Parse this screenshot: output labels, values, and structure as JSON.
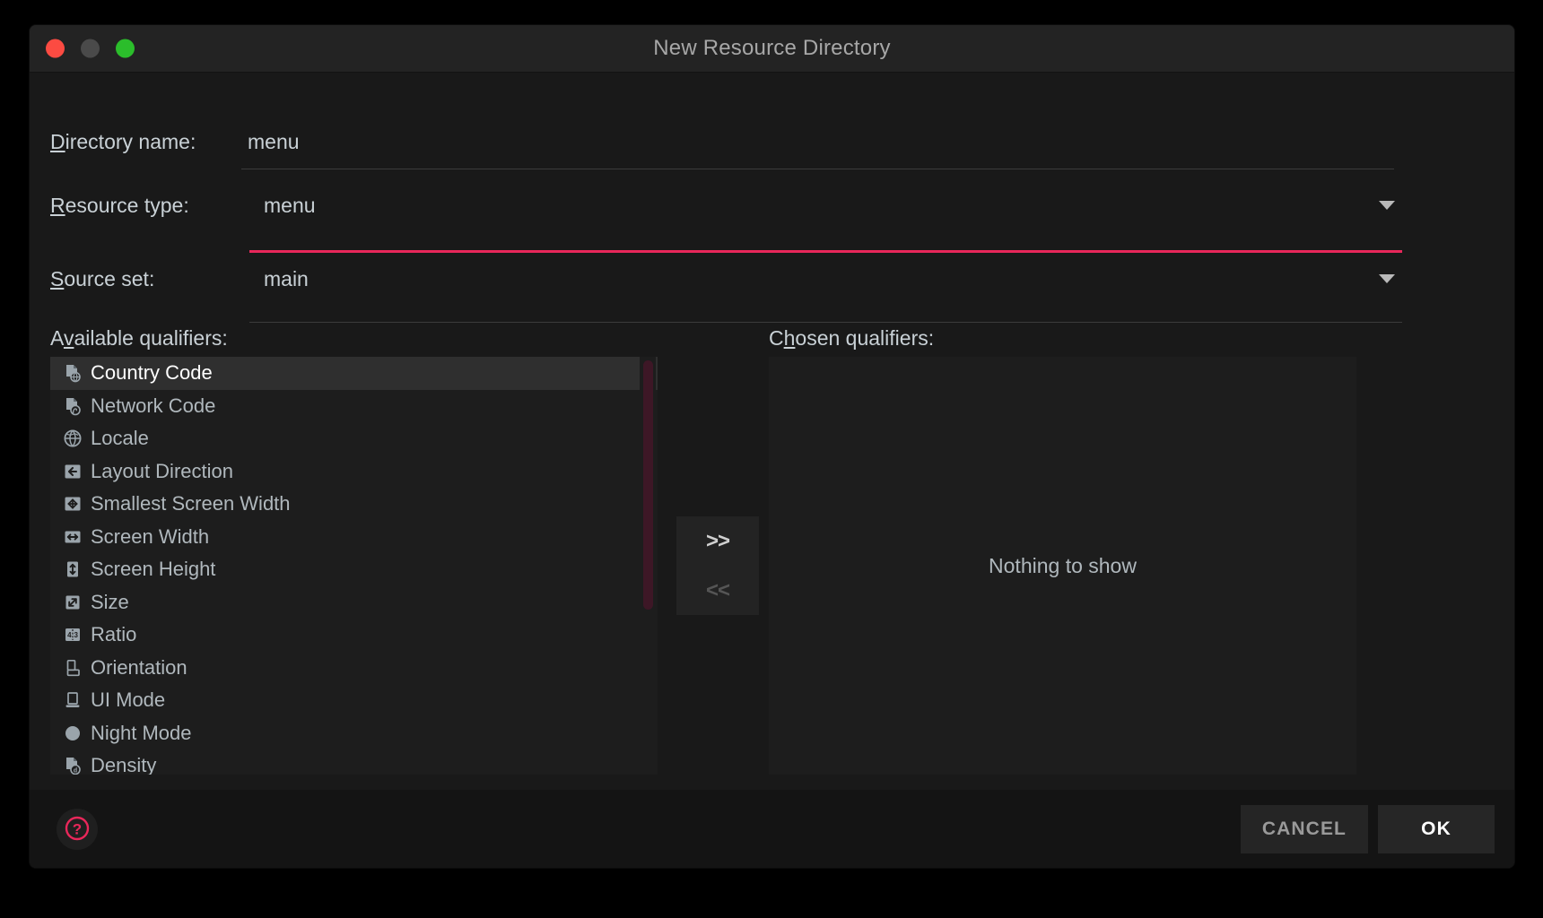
{
  "window": {
    "title": "New Resource Directory",
    "controls": {
      "close": "close",
      "minimize": "minimize",
      "maximize": "maximize"
    }
  },
  "form": {
    "directory_name": {
      "label": "Directory name:",
      "mnemonic": "D",
      "value": "menu"
    },
    "resource_type": {
      "label": "Resource type:",
      "mnemonic": "R",
      "value": "menu",
      "focused": true,
      "focus_color": "#e8275a"
    },
    "source_set": {
      "label": "Source set:",
      "mnemonic": "S",
      "value": "main"
    }
  },
  "qualifiers": {
    "available_label": "Available qualifiers:",
    "available_mnemonic": "v",
    "chosen_label": "Chosen qualifiers:",
    "chosen_mnemonic": "h",
    "chosen_empty_text": "Nothing to show",
    "available_items": [
      {
        "label": "Country Code",
        "icon": "country-code-icon",
        "selected": true
      },
      {
        "label": "Network Code",
        "icon": "network-code-icon",
        "selected": false
      },
      {
        "label": "Locale",
        "icon": "locale-globe-icon",
        "selected": false
      },
      {
        "label": "Layout Direction",
        "icon": "layout-direction-icon",
        "selected": false
      },
      {
        "label": "Smallest Screen Width",
        "icon": "smallest-screen-width-icon",
        "selected": false
      },
      {
        "label": "Screen Width",
        "icon": "screen-width-icon",
        "selected": false
      },
      {
        "label": "Screen Height",
        "icon": "screen-height-icon",
        "selected": false
      },
      {
        "label": "Size",
        "icon": "size-icon",
        "selected": false
      },
      {
        "label": "Ratio",
        "icon": "ratio-icon",
        "selected": false
      },
      {
        "label": "Orientation",
        "icon": "orientation-icon",
        "selected": false
      },
      {
        "label": "UI Mode",
        "icon": "ui-mode-icon",
        "selected": false
      },
      {
        "label": "Night Mode",
        "icon": "night-mode-icon",
        "selected": false
      },
      {
        "label": "Density",
        "icon": "density-icon",
        "selected": false
      }
    ]
  },
  "transfer": {
    "add_label": ">>",
    "add_enabled": true,
    "remove_label": "<<",
    "remove_enabled": false
  },
  "footer": {
    "help_icon": "help-question-icon",
    "help_color": "#e8275a",
    "cancel_label": "CANCEL",
    "ok_label": "OK"
  }
}
